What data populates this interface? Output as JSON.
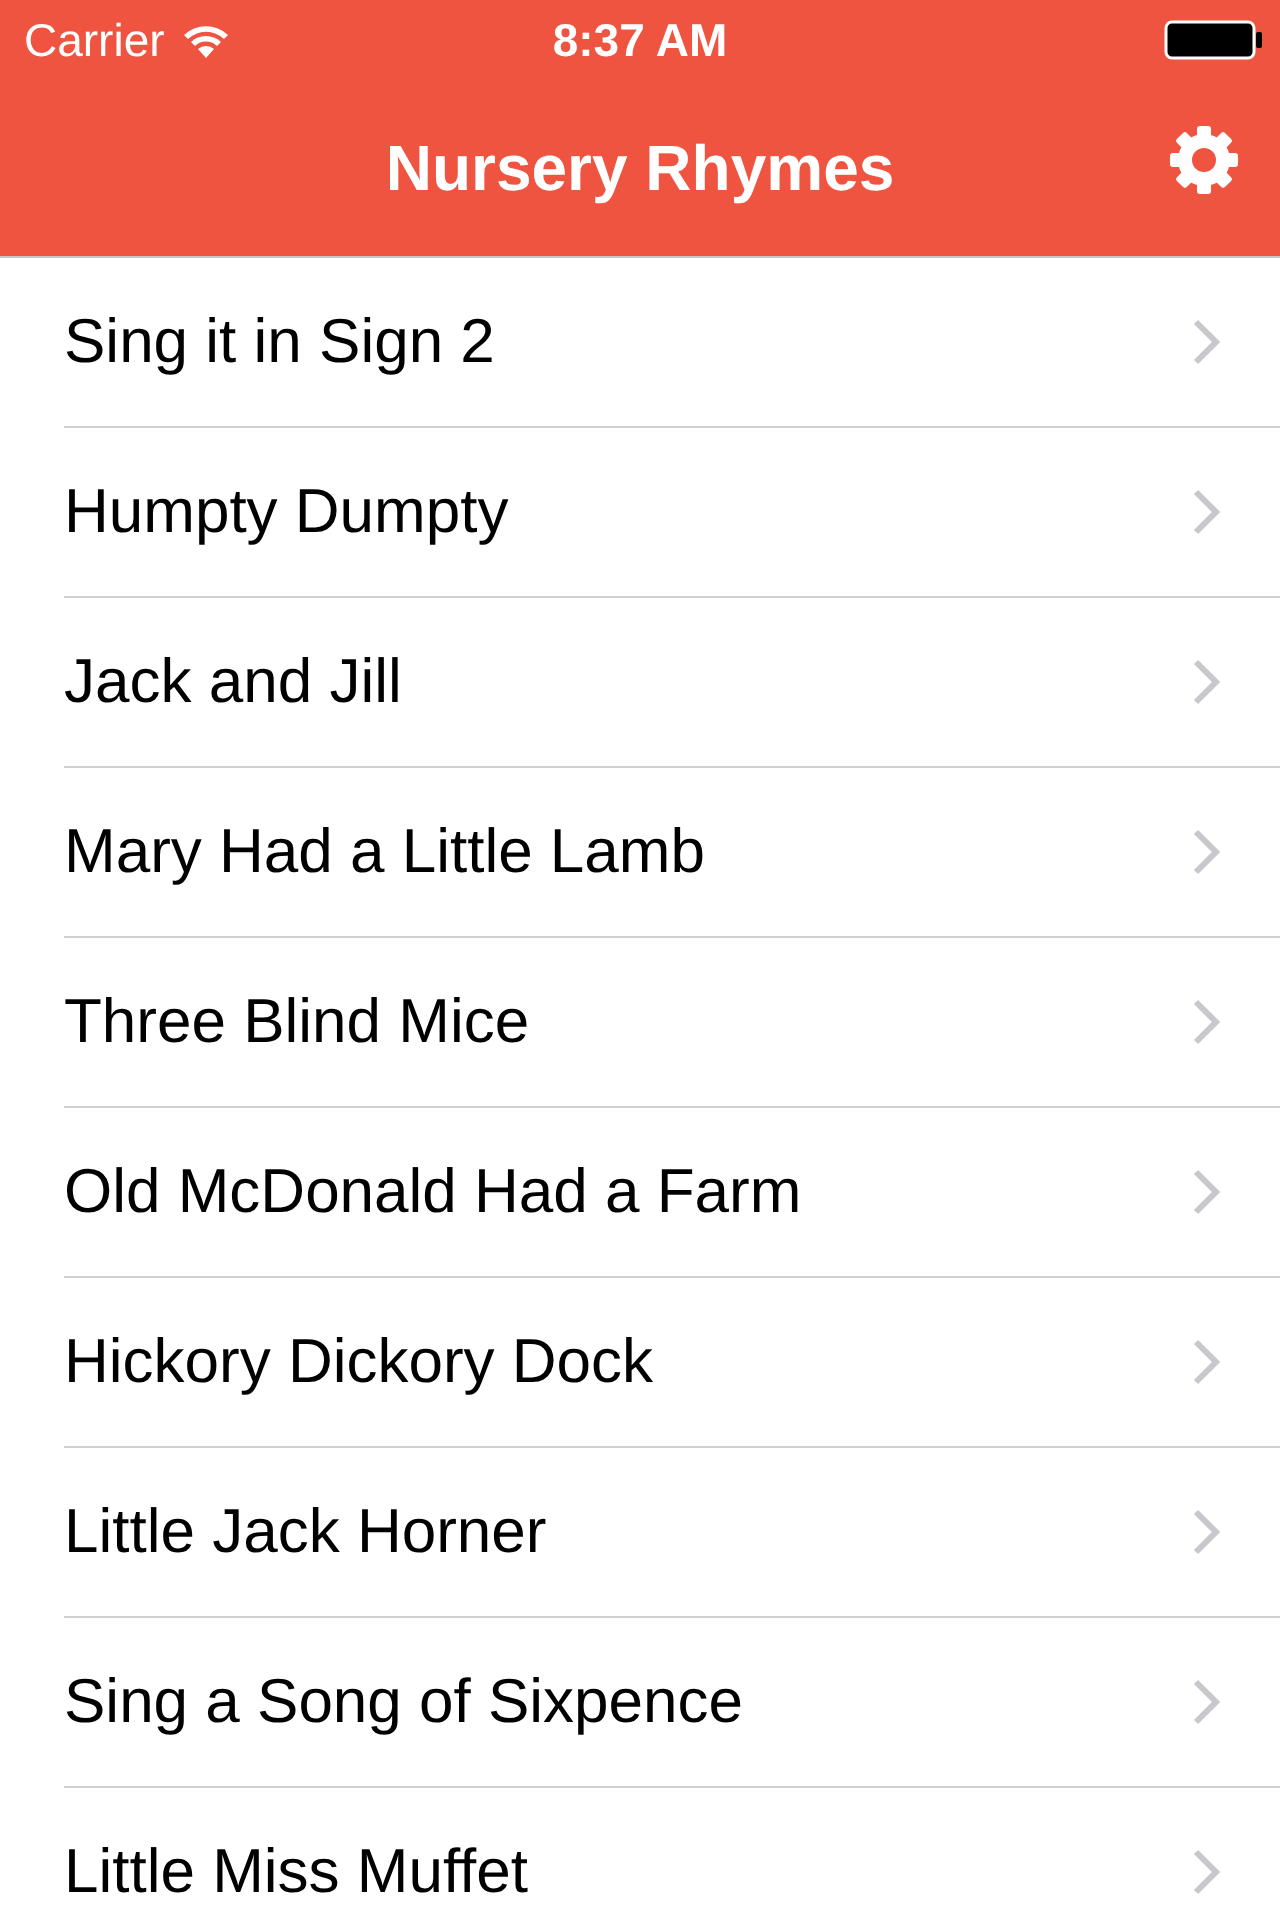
{
  "status_bar": {
    "carrier": "Carrier",
    "time": "8:37 AM"
  },
  "nav_bar": {
    "title": "Nursery Rhymes"
  },
  "rows": [
    {
      "label": "Sing it in Sign 2"
    },
    {
      "label": "Humpty Dumpty"
    },
    {
      "label": "Jack and Jill"
    },
    {
      "label": "Mary Had a Little Lamb"
    },
    {
      "label": "Three Blind Mice"
    },
    {
      "label": "Old McDonald Had a Farm"
    },
    {
      "label": "Hickory Dickory Dock"
    },
    {
      "label": "Little Jack Horner"
    },
    {
      "label": "Sing a Song of Sixpence"
    },
    {
      "label": "Little Miss Muffet"
    }
  ]
}
